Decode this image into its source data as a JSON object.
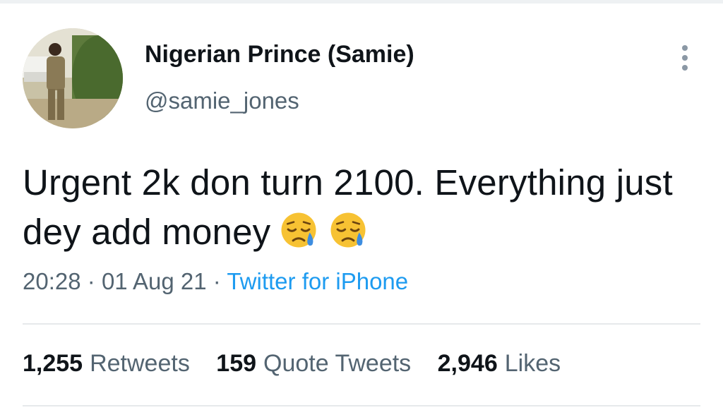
{
  "author": {
    "name": "Nigerian Prince (Samie)",
    "handle": "@samie_jones"
  },
  "tweet": {
    "text": "Urgent 2k don turn 2100. Everything just dey add money",
    "emojis": [
      "sad-but-relieved-face-icon",
      "sad-but-relieved-face-icon"
    ]
  },
  "meta": {
    "time": "20:28",
    "sep1": "·",
    "date": "01 Aug 21",
    "sep2": "·",
    "source": "Twitter for iPhone"
  },
  "stats": {
    "retweets": {
      "count": "1,255",
      "label": "Retweets"
    },
    "quotes": {
      "count": "159",
      "label": "Quote Tweets"
    },
    "likes": {
      "count": "2,946",
      "label": "Likes"
    }
  },
  "colors": {
    "text": "#0f1419",
    "secondary": "#536471",
    "link": "#1d9bf0",
    "divider": "#e6e9eb"
  }
}
